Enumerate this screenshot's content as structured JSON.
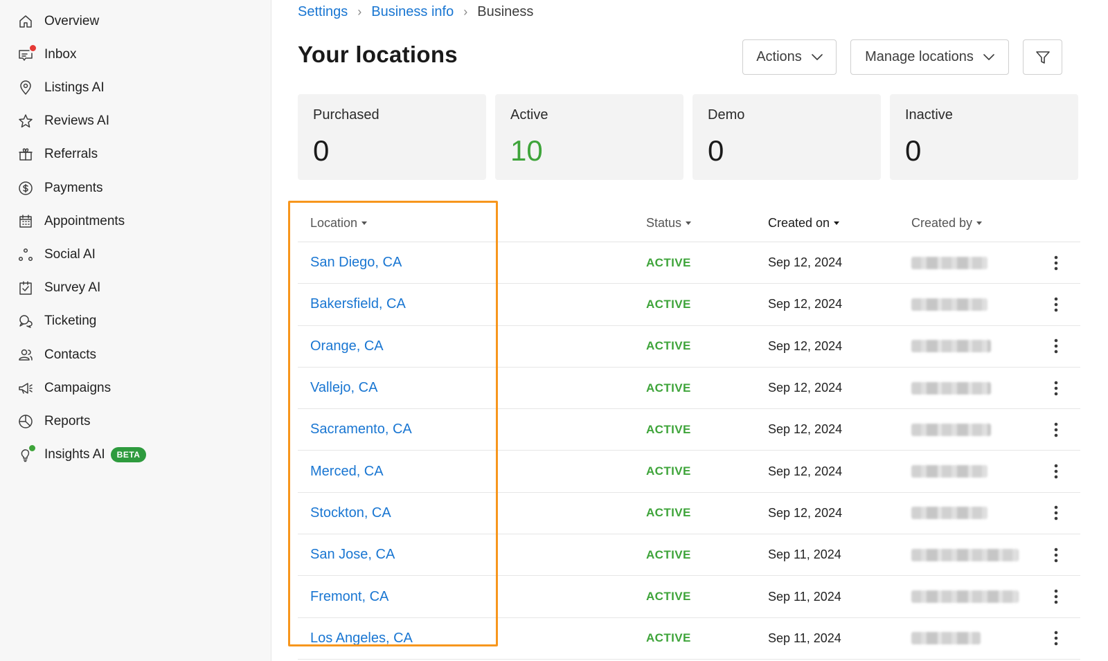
{
  "sidebar": {
    "items": [
      {
        "label": "Overview",
        "icon": "home-icon"
      },
      {
        "label": "Inbox",
        "icon": "inbox-icon",
        "dot_color": "#e53935"
      },
      {
        "label": "Listings AI",
        "icon": "location-pin-icon"
      },
      {
        "label": "Reviews AI",
        "icon": "star-icon"
      },
      {
        "label": "Referrals",
        "icon": "gift-icon"
      },
      {
        "label": "Payments",
        "icon": "dollar-circle-icon"
      },
      {
        "label": "Appointments",
        "icon": "calendar-icon"
      },
      {
        "label": "Social AI",
        "icon": "share-nodes-icon"
      },
      {
        "label": "Survey AI",
        "icon": "clipboard-check-icon"
      },
      {
        "label": "Ticketing",
        "icon": "chat-bubbles-icon"
      },
      {
        "label": "Contacts",
        "icon": "people-icon"
      },
      {
        "label": "Campaigns",
        "icon": "megaphone-icon"
      },
      {
        "label": "Reports",
        "icon": "pie-chart-icon"
      },
      {
        "label": "Insights AI",
        "icon": "lightbulb-icon",
        "badge": "BETA",
        "dot_color": "#3ea43a"
      }
    ]
  },
  "breadcrumb": {
    "items": [
      "Settings",
      "Business info"
    ],
    "current": "Business"
  },
  "header": {
    "title": "Your locations"
  },
  "toolbar": {
    "actions_label": "Actions",
    "manage_label": "Manage locations"
  },
  "stats": [
    {
      "label": "Purchased",
      "value": "0"
    },
    {
      "label": "Active",
      "value": "10"
    },
    {
      "label": "Demo",
      "value": "0"
    },
    {
      "label": "Inactive",
      "value": "0"
    }
  ],
  "table": {
    "columns": [
      "Location",
      "Status",
      "Created on",
      "Created by"
    ],
    "rows": [
      {
        "location": "San Diego, CA",
        "status": "ACTIVE",
        "created_on": "Sep 12, 2024"
      },
      {
        "location": "Bakersfield, CA",
        "status": "ACTIVE",
        "created_on": "Sep 12, 2024"
      },
      {
        "location": "Orange, CA",
        "status": "ACTIVE",
        "created_on": "Sep 12, 2024"
      },
      {
        "location": "Vallejo, CA",
        "status": "ACTIVE",
        "created_on": "Sep 12, 2024"
      },
      {
        "location": "Sacramento, CA",
        "status": "ACTIVE",
        "created_on": "Sep 12, 2024"
      },
      {
        "location": "Merced, CA",
        "status": "ACTIVE",
        "created_on": "Sep 12, 2024"
      },
      {
        "location": "Stockton, CA",
        "status": "ACTIVE",
        "created_on": "Sep 12, 2024"
      },
      {
        "location": "San Jose, CA",
        "status": "ACTIVE",
        "created_on": "Sep 11, 2024"
      },
      {
        "location": "Fremont, CA",
        "status": "ACTIVE",
        "created_on": "Sep 11, 2024"
      },
      {
        "location": "Los Angeles, CA",
        "status": "ACTIVE",
        "created_on": "Sep 11, 2024"
      }
    ]
  },
  "colors": {
    "accent": "#1976d2",
    "active_green": "#3ea43a",
    "highlight": "#f7961d"
  }
}
